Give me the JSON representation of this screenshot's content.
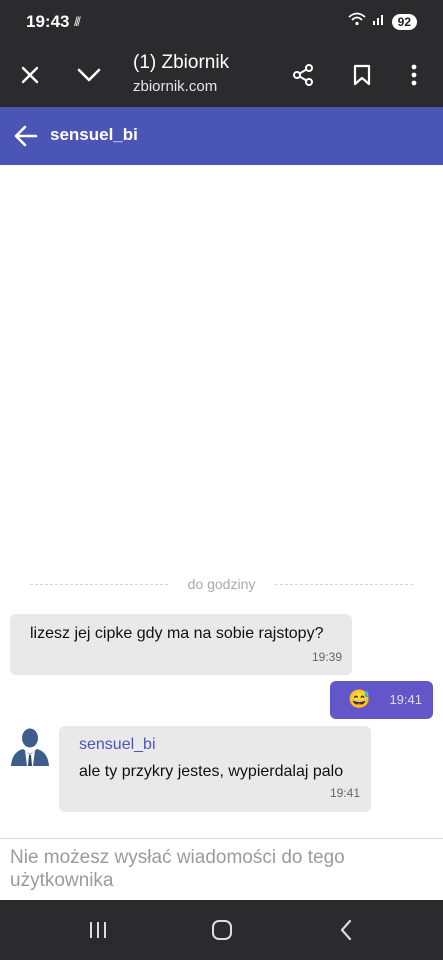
{
  "status_bar": {
    "time": "19:43",
    "extra": "///",
    "battery": "92",
    "icons": [
      "wifi-icon",
      "signal-icon",
      "battery-icon"
    ]
  },
  "browser": {
    "tab_title": "(1) Zbiornik",
    "url": "zbiornik.com",
    "icons": [
      "close-icon",
      "chevron-down-icon",
      "share-icon",
      "bookmark-icon",
      "more-vert-icon"
    ]
  },
  "header": {
    "username": "sensuel_bi",
    "icon": "arrow-left-icon"
  },
  "chat": {
    "divider_label": "do godziny",
    "messages": [
      {
        "direction": "incoming",
        "text": "lizesz jej cipke gdy ma na sobie rajstopy?",
        "time": "19:39"
      },
      {
        "direction": "outgoing",
        "text": "😅",
        "time": "19:41"
      },
      {
        "direction": "incoming",
        "sender": "sensuel_bi",
        "text": "ale ty przykry jestes, wypierdalaj palo",
        "time": "19:41"
      }
    ]
  },
  "compose": {
    "notice": "Nie możesz wysłać wiadomości do tego użytkownika"
  },
  "nav_bar": {
    "icons": [
      "recent-apps-icon",
      "home-icon",
      "back-icon"
    ]
  },
  "colors": {
    "header_bg": "#4b55b6",
    "outgoing_bubble": "#6256c9",
    "incoming_bubble": "#e9e9ea",
    "system_bar": "#2b2b2d",
    "sender_name": "#4b55b6"
  }
}
